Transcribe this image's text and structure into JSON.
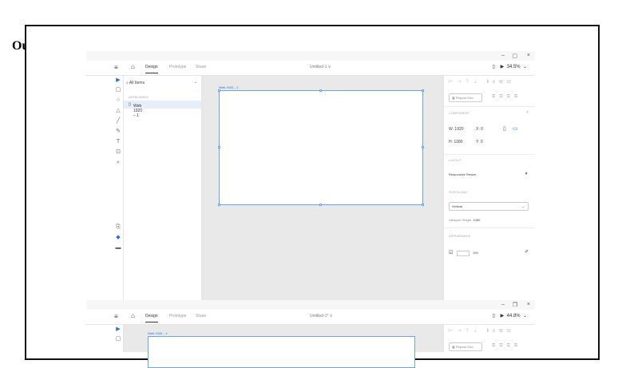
{
  "output_label": "Output:",
  "window": {
    "minimize": "–",
    "maximize": "▢",
    "close": "×",
    "maximize2": "❐"
  },
  "topbar": {
    "tabs": [
      "Design",
      "Prototype",
      "Share"
    ],
    "doc_title": "Untitled-1 ∨",
    "zoom": "34.5%",
    "zoom2": "44.8%",
    "doc_title2": "Untitled-1* ∨"
  },
  "layers": {
    "header": "All Items",
    "section": "ARTBOARDS",
    "item": "Web 1920 – 1"
  },
  "canvas": {
    "artboard_label": "Web 1920 – 1"
  },
  "props": {
    "repeat_grid": "Repeat Grid",
    "component": "COMPONENT",
    "w_label": "W",
    "w_value": "1920",
    "h_label": "H",
    "h_value": "1080",
    "x_label": "X",
    "x_value": "0",
    "y_label": "Y",
    "y_value": "0",
    "layout": "LAYOUT",
    "responsive_resize": "Responsive Resize",
    "scrolling": "SCROLLING",
    "scroll_value": "Vertical",
    "viewport_label": "Viewport Height",
    "viewport_value": "1080",
    "appearance": "APPEARANCE",
    "opacity": "100"
  }
}
